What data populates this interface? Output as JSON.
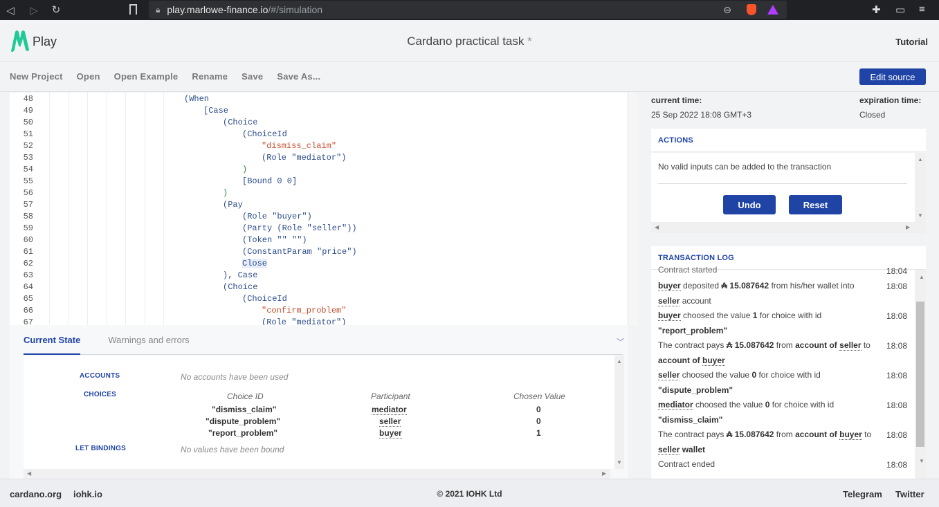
{
  "browser": {
    "url_host": "play.marlowe-finance.io",
    "url_path": "/#/simulation"
  },
  "header": {
    "logo_text": "Play",
    "project_title": "Cardano practical task",
    "dirty_marker": "*",
    "tutorial": "Tutorial"
  },
  "toolbar": {
    "items": [
      "New Project",
      "Open",
      "Open Example",
      "Rename",
      "Save",
      "Save As..."
    ],
    "edit_source": "Edit source"
  },
  "editor": {
    "line_numbers": [
      "48",
      "49",
      "50",
      "51",
      "52",
      "53",
      "54",
      "55",
      "56",
      "57",
      "58",
      "59",
      "60",
      "61",
      "62",
      "63",
      "64",
      "65",
      "66",
      "67"
    ],
    "lines": [
      "(When",
      "[Case",
      "(Choice",
      "(ChoiceId",
      "\"dismiss_claim\"",
      "(Role \"mediator\")",
      ")",
      "[Bound 0 0]",
      ")",
      "(Pay",
      "(Role \"buyer\")",
      "(Party (Role \"seller\"))",
      "(Token \"\" \"\")",
      "(ConstantParam \"price\")",
      "Close",
      "), Case",
      "(Choice",
      "(ChoiceId",
      "\"confirm_problem\"",
      "(Role \"mediator\")"
    ]
  },
  "bottom_panel": {
    "tabs": [
      "Current State",
      "Warnings and errors"
    ],
    "accounts_label": "ACCOUNTS",
    "accounts_empty": "No accounts have been used",
    "choices_label": "CHOICES",
    "choices_headers": [
      "Choice ID",
      "Participant",
      "Chosen Value"
    ],
    "choices": [
      {
        "id": "\"dismiss_claim\"",
        "participant": "mediator",
        "value": "0"
      },
      {
        "id": "\"dispute_problem\"",
        "participant": "seller",
        "value": "0"
      },
      {
        "id": "\"report_problem\"",
        "participant": "buyer",
        "value": "1"
      }
    ],
    "let_label": "LET BINDINGS",
    "let_empty": "No values have been bound"
  },
  "right": {
    "current_time_label": "current time:",
    "current_time": "25 Sep 2022 18:08 GMT+3",
    "expiration_label": "expiration time:",
    "expiration": "Closed",
    "actions_title": "ACTIONS",
    "actions_msg": "No valid inputs can be added to the transaction",
    "undo": "Undo",
    "reset": "Reset",
    "log_title": "TRANSACTION LOG",
    "log": [
      {
        "time": "18:04",
        "text": "Contract started"
      },
      {
        "time": "18:08",
        "text": "buyer deposited ₳ 15.087642 from his/her wallet into seller account"
      },
      {
        "time": "18:08",
        "text": "buyer choosed the value 1 for choice with id \"report_problem\""
      },
      {
        "time": "18:08",
        "text": "The contract pays ₳ 15.087642 from account of seller to account of buyer"
      },
      {
        "time": "18:08",
        "text": "seller choosed the value 0 for choice with id \"dispute_problem\""
      },
      {
        "time": "18:08",
        "text": "mediator choosed the value 0 for choice with id \"dismiss_claim\""
      },
      {
        "time": "18:08",
        "text": "The contract pays ₳ 15.087642 from account of buyer to seller wallet"
      },
      {
        "time": "18:08",
        "text": "Contract ended"
      }
    ]
  },
  "footer": {
    "cardano": "cardano.org",
    "iohk": "iohk.io",
    "copyright": "© 2021 IOHK Ltd",
    "telegram": "Telegram",
    "twitter": "Twitter"
  }
}
